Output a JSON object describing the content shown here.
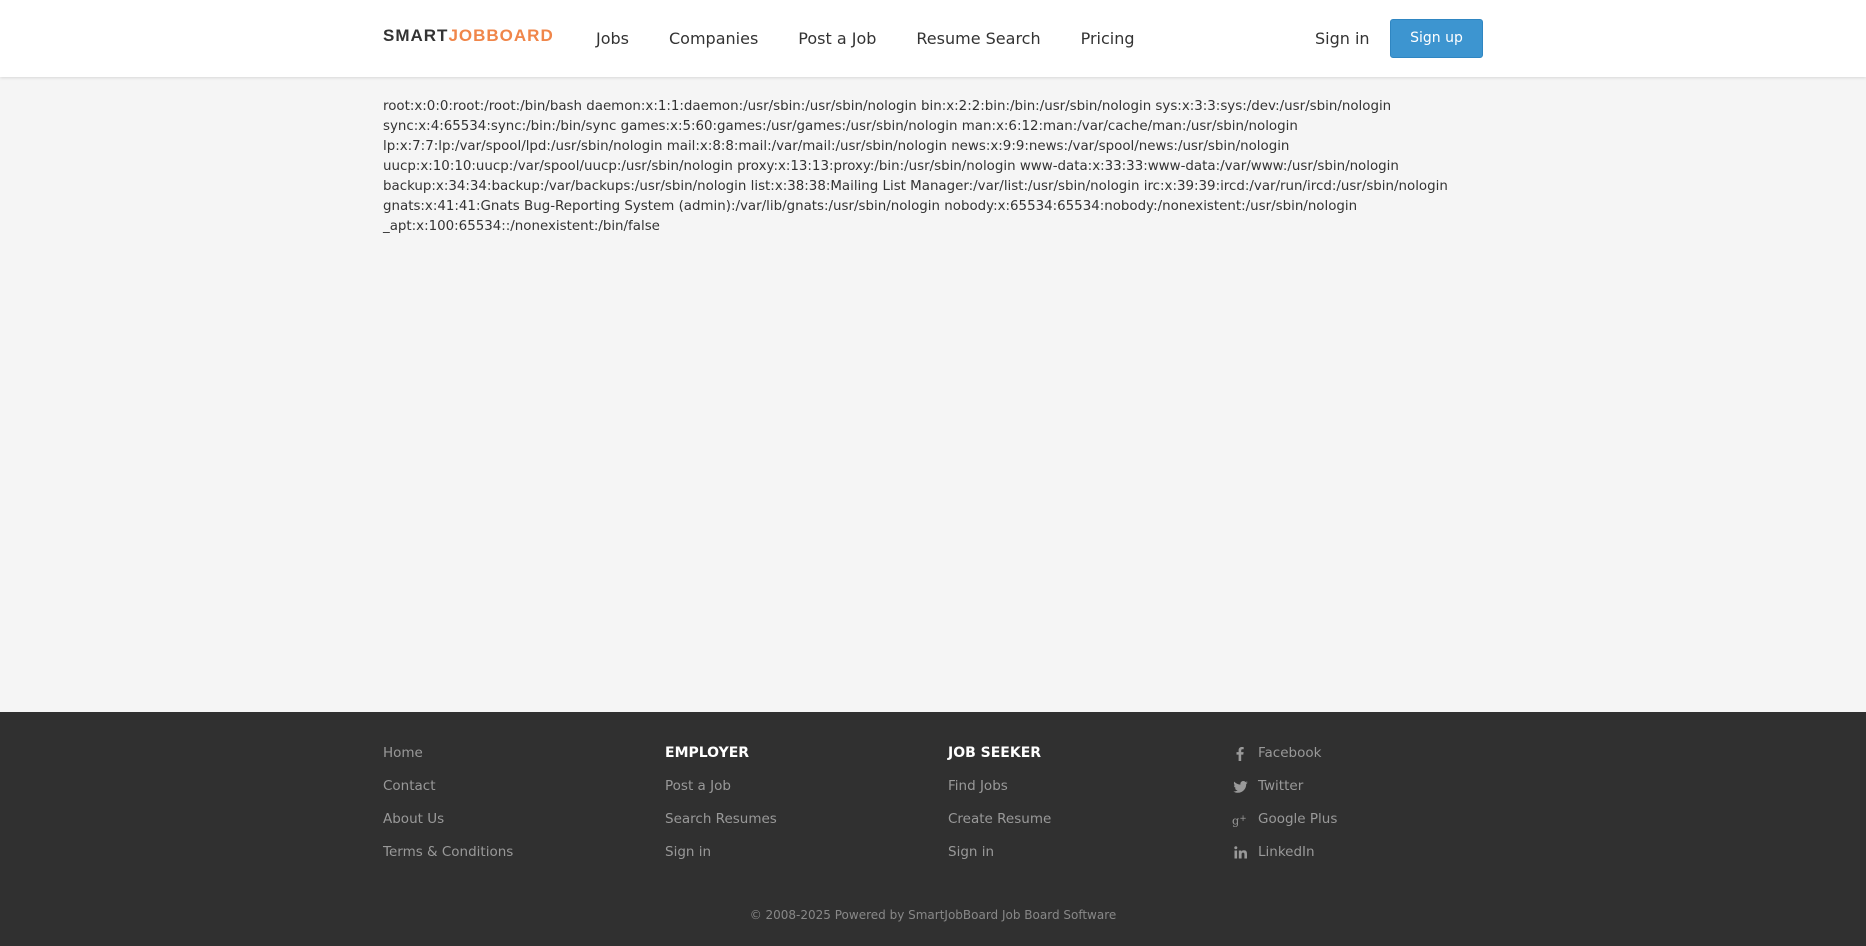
{
  "header": {
    "logo_part1": "SMART",
    "logo_part2": "JOBBOARD",
    "nav": [
      "Jobs",
      "Companies",
      "Post a Job",
      "Resume Search",
      "Pricing"
    ],
    "signin_label": "Sign in",
    "signup_label": "Sign up"
  },
  "content": {
    "lines": [
      "root:x:0:0:root:/root:/bin/bash daemon:x:1:1:daemon:/usr/sbin:/usr/sbin/nologin bin:x:2:2:bin:/bin:/usr/sbin/nologin sys:x:3:3:sys:/dev:/usr/sbin/nologin",
      "sync:x:4:65534:sync:/bin:/bin/sync games:x:5:60:games:/usr/games:/usr/sbin/nologin man:x:6:12:man:/var/cache/man:/usr/sbin/nologin",
      "lp:x:7:7:lp:/var/spool/lpd:/usr/sbin/nologin mail:x:8:8:mail:/var/mail:/usr/sbin/nologin news:x:9:9:news:/var/spool/news:/usr/sbin/nologin",
      "uucp:x:10:10:uucp:/var/spool/uucp:/usr/sbin/nologin proxy:x:13:13:proxy:/bin:/usr/sbin/nologin www-data:x:33:33:www-data:/var/www:/usr/sbin/nologin",
      "backup:x:34:34:backup:/var/backups:/usr/sbin/nologin list:x:38:38:Mailing List Manager:/var/list:/usr/sbin/nologin irc:x:39:39:ircd:/var/run/ircd:/usr/sbin/nologin",
      "gnats:x:41:41:Gnats Bug-Reporting System (admin):/var/lib/gnats:/usr/sbin/nologin nobody:x:65534:65534:nobody:/nonexistent:/usr/sbin/nologin",
      "_apt:x:100:65534::/nonexistent:/bin/false"
    ]
  },
  "footer": {
    "col1": [
      "Home",
      "Contact",
      "About Us",
      "Terms & Conditions"
    ],
    "employer": {
      "heading": "EMPLOYER",
      "links": [
        "Post a Job",
        "Search Resumes",
        "Sign in"
      ]
    },
    "jobseeker": {
      "heading": "JOB SEEKER",
      "links": [
        "Find Jobs",
        "Create Resume",
        "Sign in"
      ]
    },
    "social": [
      {
        "label": "Facebook",
        "icon": "facebook-icon"
      },
      {
        "label": "Twitter",
        "icon": "twitter-icon"
      },
      {
        "label": "Google Plus",
        "icon": "google-plus-icon"
      },
      {
        "label": "LinkedIn",
        "icon": "linkedin-icon"
      }
    ],
    "copyright": "© 2008-2025 Powered by SmartJobBoard Job Board Software"
  },
  "colors": {
    "brand_accent": "#f0864a",
    "signup_button": "#3d95d0",
    "footer_bg": "#303030",
    "page_bg": "#f5f5f5"
  }
}
